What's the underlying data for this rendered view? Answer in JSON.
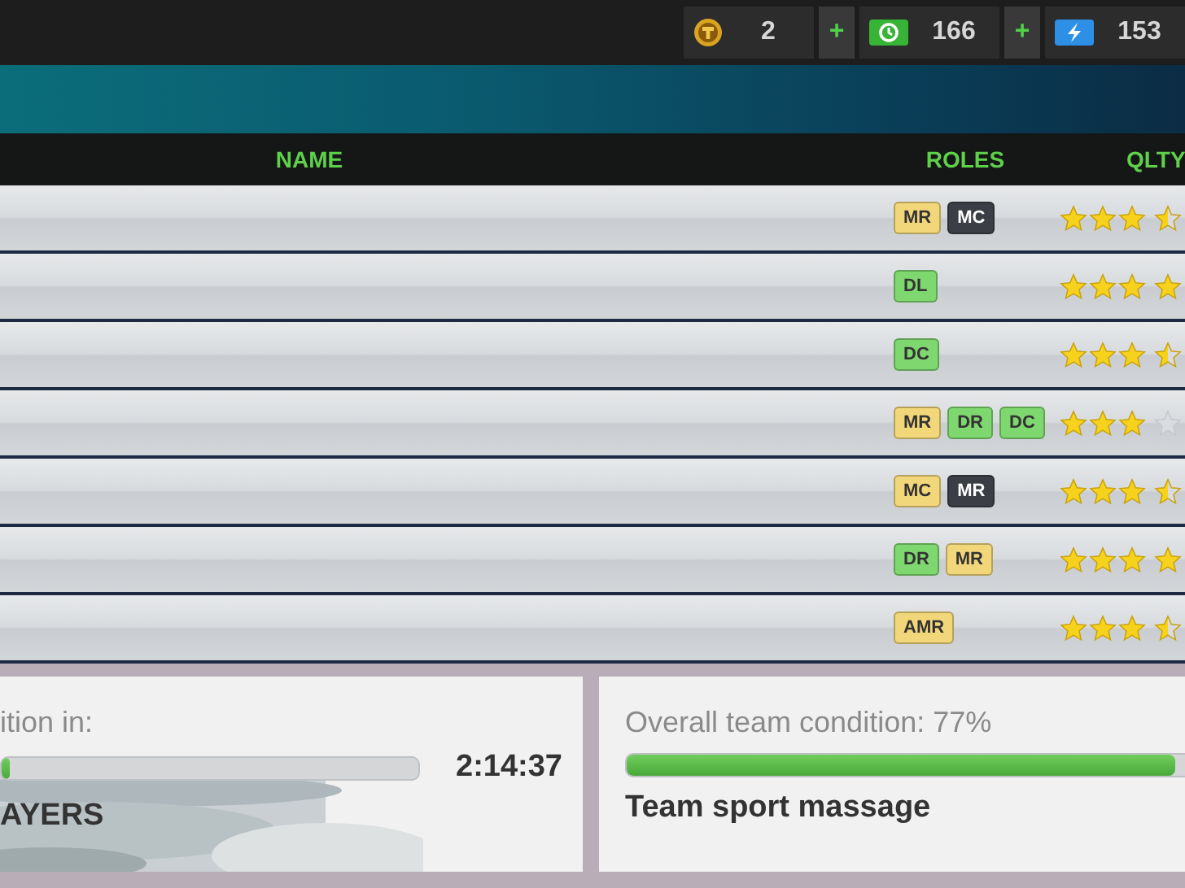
{
  "currencies": [
    {
      "kind": "coin",
      "value": "2",
      "plus": "+"
    },
    {
      "kind": "cash",
      "value": "166",
      "plus": "+"
    },
    {
      "kind": "energy",
      "value": "153"
    }
  ],
  "table": {
    "columns": [
      "NAME",
      "ROLES",
      "QLTY"
    ],
    "rows": [
      {
        "roles": [
          {
            "label": "MR",
            "color": "#f2d77a"
          },
          {
            "label": "MC",
            "color": "#3b3e45"
          }
        ],
        "stars": 3.5
      },
      {
        "roles": [
          {
            "label": "DL",
            "color": "#7fd86f"
          }
        ],
        "stars": 4
      },
      {
        "roles": [
          {
            "label": "DC",
            "color": "#7fd86f"
          }
        ],
        "stars": 3.5
      },
      {
        "roles": [
          {
            "label": "MR",
            "color": "#f2d77a"
          },
          {
            "label": "DR",
            "color": "#7fd86f"
          },
          {
            "label": "DC",
            "color": "#7fd86f"
          }
        ],
        "stars": 3
      },
      {
        "roles": [
          {
            "label": "MC",
            "color": "#f2d77a"
          },
          {
            "label": "MR",
            "color": "#3b3e45"
          }
        ],
        "stars": 3.5
      },
      {
        "roles": [
          {
            "label": "DR",
            "color": "#7fd86f"
          },
          {
            "label": "MR",
            "color": "#f2d77a"
          }
        ],
        "stars": 4
      },
      {
        "roles": [
          {
            "label": "AMR",
            "color": "#f2d77a"
          }
        ],
        "stars": 3.5
      }
    ]
  },
  "condition_timer": {
    "label": "ition in:",
    "level": 0.02,
    "time": "2:14:37",
    "action": "AYERS"
  },
  "team_condition": {
    "label": "Overall team condition: 77%",
    "level": 0.77,
    "action": "Team sport massage"
  }
}
